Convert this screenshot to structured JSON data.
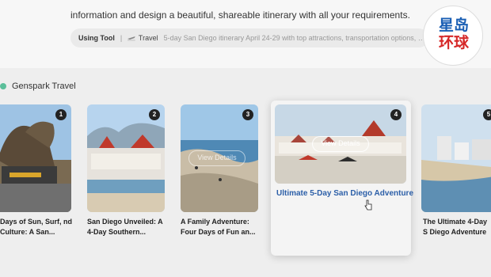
{
  "intro": "information and design a beautiful, shareable itinerary with all your requirements.",
  "tool": {
    "label": "Using Tool",
    "separator": "|",
    "name": "Travel",
    "description": "5-day San Diego itinerary April 24-29 with top attractions, transportation options, bea..."
  },
  "logo": {
    "line1": "星岛",
    "line2": "环球"
  },
  "section": {
    "title": "Genspark Travel"
  },
  "cards": [
    {
      "number": "1",
      "caption": "Days of Sun, Surf, nd Culture: A San..."
    },
    {
      "number": "2",
      "caption": "San Diego Unveiled: A 4-Day Southern..."
    },
    {
      "number": "3",
      "caption": "A Family Adventure: Four Days of Fun an..."
    },
    {
      "number": "4",
      "caption": "Ultimate 5-Day San Diego Adventure"
    },
    {
      "number": "5",
      "caption": "The Ultimate 4-Day S Diego Adventure"
    }
  ],
  "view_details_label": "View Details",
  "colors": {
    "accent_title": "#2c5fa8",
    "badge": "#222222",
    "section_dot": "#5bbf9a"
  }
}
